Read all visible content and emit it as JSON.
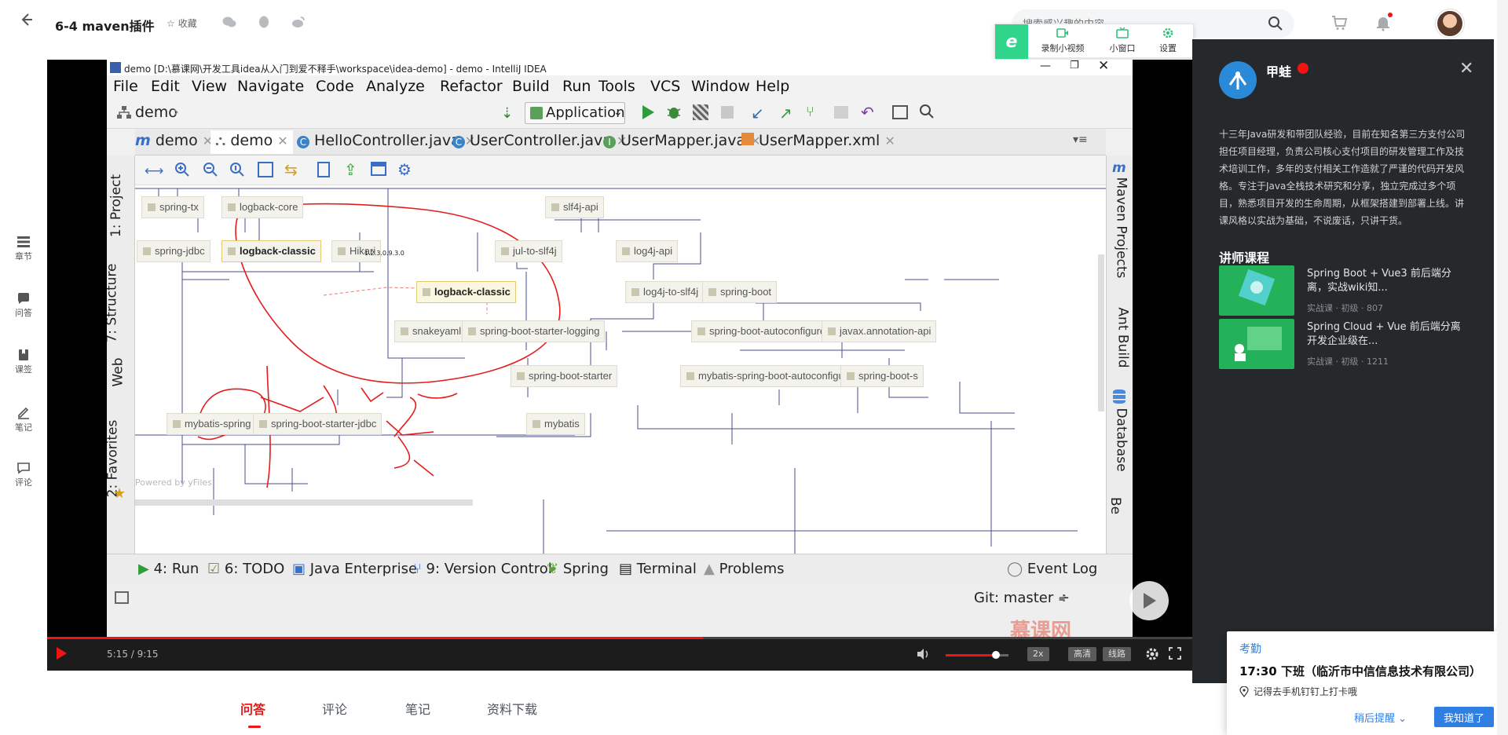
{
  "header": {
    "title": "6-4 maven插件",
    "favorite_label": "收藏",
    "search_placeholder": "搜索感兴趣的内容"
  },
  "recorder": {
    "logo": "e",
    "buttons": [
      {
        "label": "录制小视频"
      },
      {
        "label": "小窗口"
      },
      {
        "label": "设置"
      }
    ]
  },
  "left_sidebar": {
    "items": [
      {
        "label": "章节"
      },
      {
        "label": "问答"
      },
      {
        "label": "课签"
      },
      {
        "label": "笔记"
      },
      {
        "label": "评论"
      }
    ]
  },
  "ide": {
    "title": "demo [D:\\慕课网\\开发工具idea从入门到爱不释手\\workspace\\idea-demo] - demo - IntelliJ IDEA",
    "menu": [
      "File",
      "Edit",
      "View",
      "Navigate",
      "Code",
      "Analyze",
      "Refactor",
      "Build",
      "Run",
      "Tools",
      "VCS",
      "Window",
      "Help"
    ],
    "breadcrumb": "demo",
    "run_config": "Application",
    "tabs": [
      {
        "label": "demo"
      },
      {
        "label": "demo"
      },
      {
        "label": "HelloController.java"
      },
      {
        "label": "UserController.java"
      },
      {
        "label": "UserMapper.java"
      },
      {
        "label": "UserMapper.xml"
      }
    ],
    "left_tools": [
      "1: Project",
      "7: Structure",
      "Web",
      "2: Favorites"
    ],
    "right_tools": [
      "Maven Projects",
      "Ant Build",
      "Database",
      "Be"
    ],
    "diagram_nodes": [
      {
        "label": "spring-tx"
      },
      {
        "label": "logback-core"
      },
      {
        "label": "slf4j-api"
      },
      {
        "label": "spring-jdbc"
      },
      {
        "label": "logback-classic"
      },
      {
        "label": "Hikari"
      },
      {
        "label": "jul-to-slf4j"
      },
      {
        "label": "log4j-api"
      },
      {
        "label": "logback-classic"
      },
      {
        "label": "log4j-to-slf4j"
      },
      {
        "label": "spring-boot"
      },
      {
        "label": "snakeyaml"
      },
      {
        "label": "spring-boot-starter-logging"
      },
      {
        "label": "spring-boot-autoconfigure"
      },
      {
        "label": "javax.annotation-api"
      },
      {
        "label": "spring-boot-starter"
      },
      {
        "label": "mybatis-spring-boot-autoconfigure"
      },
      {
        "label": "spring-boot-s"
      },
      {
        "label": "mybatis-spring"
      },
      {
        "label": "spring-boot-starter-jdbc"
      },
      {
        "label": "mybatis"
      }
    ],
    "hikari_note": "1.2.3.0.9.3.0",
    "powered_by": "Powered by yFiles",
    "bottom_tools": [
      {
        "label": "4: Run"
      },
      {
        "label": "6: TODO"
      },
      {
        "label": "Java Enterprise"
      },
      {
        "label": "9: Version Control"
      },
      {
        "label": "Spring"
      },
      {
        "label": "Terminal"
      },
      {
        "label": "Problems"
      },
      {
        "label": "Event Log"
      }
    ],
    "git_branch": "Git: master ÷",
    "watermark": "慕课网"
  },
  "player": {
    "time": "5:15 / 9:15",
    "progress": 0.5728,
    "volume": 0.8,
    "speed_label": "2x",
    "quality_label": "高清",
    "route_label": "线路"
  },
  "teacher": {
    "name": "甲蛙",
    "bio": "十三年Java研发和带团队经验，目前在知名第三方支付公司担任项目经理，负责公司核心支付项目的研发管理工作及技术培训工作，多年的支付相关工作造就了严谨的代码开发风格。专注于Java全栈技术研究和分享，独立完成过多个项目，熟悉项目开发的生命周期，从框架搭建到部署上线。讲课风格以实战为基础，不说废话，只讲干货。",
    "courses_heading": "讲师课程",
    "courses": [
      {
        "title": "Spring Boot + Vue3 前后端分离，实战wiki知...",
        "meta": "实战课 · 初级 · 807"
      },
      {
        "title": "Spring Cloud + Vue 前后端分离 开发企业级在...",
        "meta": "实战课 · 初级 · 1211"
      }
    ]
  },
  "bottom_tabs": [
    {
      "label": "问答"
    },
    {
      "label": "评论"
    },
    {
      "label": "笔记"
    },
    {
      "label": "资料下载"
    }
  ],
  "attendance": {
    "title": "考勤",
    "main": "17:30 下班（临沂市中信信息技术有限公司）",
    "sub": "记得去手机钉钉上打卡哦",
    "later_label": "稍后提醒",
    "ok_label": "我知道了"
  },
  "colors": {
    "accent_red": "#f01414",
    "panel_dark": "#26292c",
    "link_blue": "#2f7fe3",
    "recorder_green": "#2fd58a"
  }
}
